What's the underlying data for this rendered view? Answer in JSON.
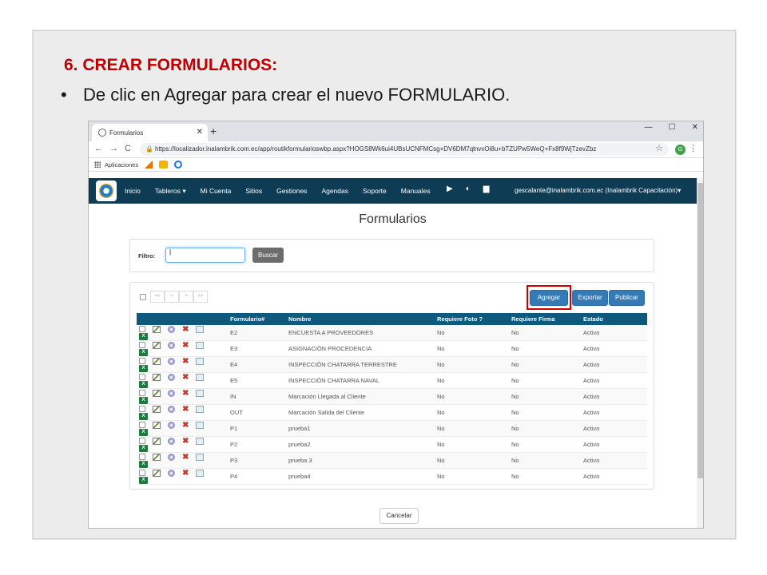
{
  "slide": {
    "title": "6. CREAR FORMULARIOS:",
    "bullet_mark": "•",
    "bullet_text": "De clic en Agregar  para crear el nuevo FORMULARIO."
  },
  "browser": {
    "tab_title": "Formularios",
    "tab_close": "✕",
    "new_tab": "+",
    "win_min": "—",
    "win_max": "☐",
    "win_close": "✕",
    "back": "←",
    "forward": "→",
    "reload": "C",
    "lock": "🔒",
    "url": "https://localizador.inalambrik.com.ec/app/routikformularioswbp.aspx?HOGS8Wk6ui4UBsUCNFMCsg+DV6DM7qlnvxOi8u+bTZUPw5WeQ+Fx8f9WjTzevZbz",
    "star": "☆",
    "profile_initial": "G",
    "menu": "⋮",
    "bookmarks_label": "Aplicaciones"
  },
  "navbar": {
    "links": [
      "Inicio",
      "Tableros ▾",
      "Mi Cuenta",
      "Sitios",
      "Gestiones",
      "Agendas",
      "Soporte",
      "Manuales"
    ],
    "icons": [
      "▶",
      "◐",
      "▆"
    ],
    "user": "gescalante@inalambrik.com.ec (Inalambrik Capacitación)▾"
  },
  "page": {
    "heading": "Formularios",
    "filter_label": "Filtro:",
    "filter_value": "|",
    "search_button": "Buscar",
    "pager": [
      "<<",
      "<",
      ">",
      ">>"
    ],
    "add_button": "Agregar",
    "export_button": "Exportar",
    "publish_button": "Publicar",
    "cancel_button": "Cancelar"
  },
  "table": {
    "headers": [
      "Formulario#",
      "Nombre",
      "Requiere Foto ?",
      "Requiere Firma",
      "Estado"
    ],
    "rows": [
      [
        "E2",
        "ENCUESTA A PROVEEDORES",
        "No",
        "No",
        "Activo"
      ],
      [
        "E3",
        "ASIGNACIÓN PROCEDENCIA",
        "No",
        "No",
        "Activo"
      ],
      [
        "E4",
        "INSPECCIÓN CHATARRA TERRESTRE",
        "No",
        "No",
        "Activo"
      ],
      [
        "E5",
        "INSPECCIÓN CHATARRA NAVAL",
        "No",
        "No",
        "Activo"
      ],
      [
        "IN",
        "Marcación Llegada al Cliente",
        "No",
        "No",
        "Activo"
      ],
      [
        "OUT",
        "Marcación Salida del Cliente",
        "No",
        "No",
        "Activo"
      ],
      [
        "P1",
        "prueba1",
        "No",
        "No",
        "Activo"
      ],
      [
        "P2",
        "prueba2",
        "No",
        "No",
        "Activo"
      ],
      [
        "P3",
        "prueba 3",
        "No",
        "No",
        "Activo"
      ],
      [
        "P4",
        "prueba4",
        "No",
        "No",
        "Activo"
      ]
    ]
  },
  "colors": {
    "title_red": "#c00000",
    "navbar": "#0e3c54",
    "table_header": "#0e5a7e",
    "button_blue": "#337ab7",
    "highlight": "#d00000"
  }
}
